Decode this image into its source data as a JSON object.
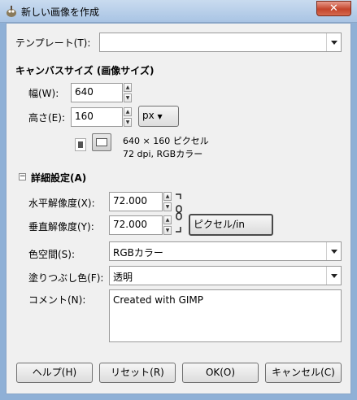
{
  "window": {
    "title": "新しい画像を作成",
    "close_label": "✕"
  },
  "template": {
    "label": "テンプレート(T):",
    "value": ""
  },
  "canvas_size": {
    "heading": "キャンバスサイズ (画像サイズ)",
    "width_label": "幅(W):",
    "width_value": "640",
    "height_label": "高さ(E):",
    "height_value": "160",
    "unit": "px",
    "info_size": "640 × 160 ピクセル",
    "info_res": "72 dpi, RGBカラー"
  },
  "advanced": {
    "heading": "詳細設定(A)",
    "toggle": "−",
    "xres_label": "水平解像度(X):",
    "xres_value": "72.000",
    "yres_label": "垂直解像度(Y):",
    "yres_value": "72.000",
    "res_unit": "ピクセル/in",
    "colorspace_label": "色空間(S):",
    "colorspace_value": "RGBカラー",
    "fill_label": "塗りつぶし色(F):",
    "fill_value": "透明",
    "comment_label": "コメント(N):",
    "comment_value": "Created with GIMP"
  },
  "buttons": {
    "help": "ヘルプ(H)",
    "reset": "リセット(R)",
    "ok": "OK(O)",
    "cancel": "キャンセル(C)"
  }
}
